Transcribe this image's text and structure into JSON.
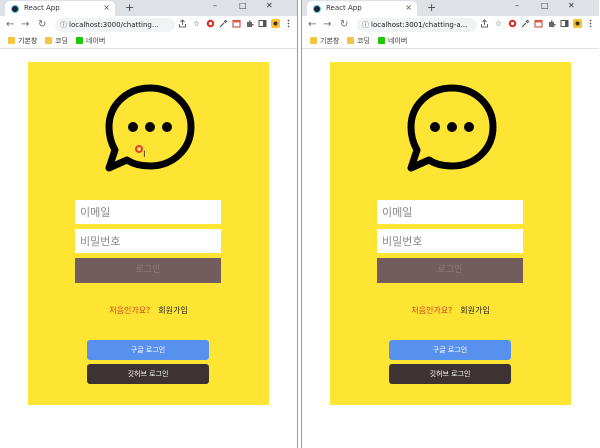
{
  "colors": {
    "card_bg": "#fee533",
    "login_button": "#735c5e",
    "google_button": "#5890ed",
    "github_button": "#3d3333",
    "signup_question": "#d13b20"
  },
  "windows": [
    {
      "tab": {
        "title": "React App",
        "favicon": "react-icon"
      },
      "url": "localhost:3000/chatting...",
      "bookmarks": [
        {
          "label": "기본창",
          "icon": "folder-icon"
        },
        {
          "label": "코딩",
          "icon": "folder-icon"
        },
        {
          "label": "네이버",
          "icon": "naver-icon"
        }
      ],
      "form": {
        "email_placeholder": "이메일",
        "password_placeholder": "비밀번호",
        "login_label": "로그인",
        "signup_question": "처음인가요?",
        "signup_link": "회원가입",
        "google_label": "구글 로그인",
        "github_label": "깃허브 로그인"
      }
    },
    {
      "tab": {
        "title": "React App",
        "favicon": "react-icon"
      },
      "url": "localhost:3001/chatting-a...",
      "bookmarks": [
        {
          "label": "기본창",
          "icon": "folder-icon"
        },
        {
          "label": "코딩",
          "icon": "folder-icon"
        },
        {
          "label": "네이버",
          "icon": "naver-icon"
        }
      ],
      "form": {
        "email_placeholder": "이메일",
        "password_placeholder": "비밀번호",
        "login_label": "로그인",
        "signup_question": "처음인가요?",
        "signup_link": "회원가입",
        "google_label": "구글 로그인",
        "github_label": "깃허브 로그인"
      }
    }
  ],
  "window_controls": [
    "–",
    "□",
    "✕"
  ],
  "glyphs": {
    "new_tab": "+",
    "tab_close": "×",
    "back": "←",
    "forward": "→",
    "reload": "↻",
    "lock": "ⓘ",
    "star": "☆"
  }
}
